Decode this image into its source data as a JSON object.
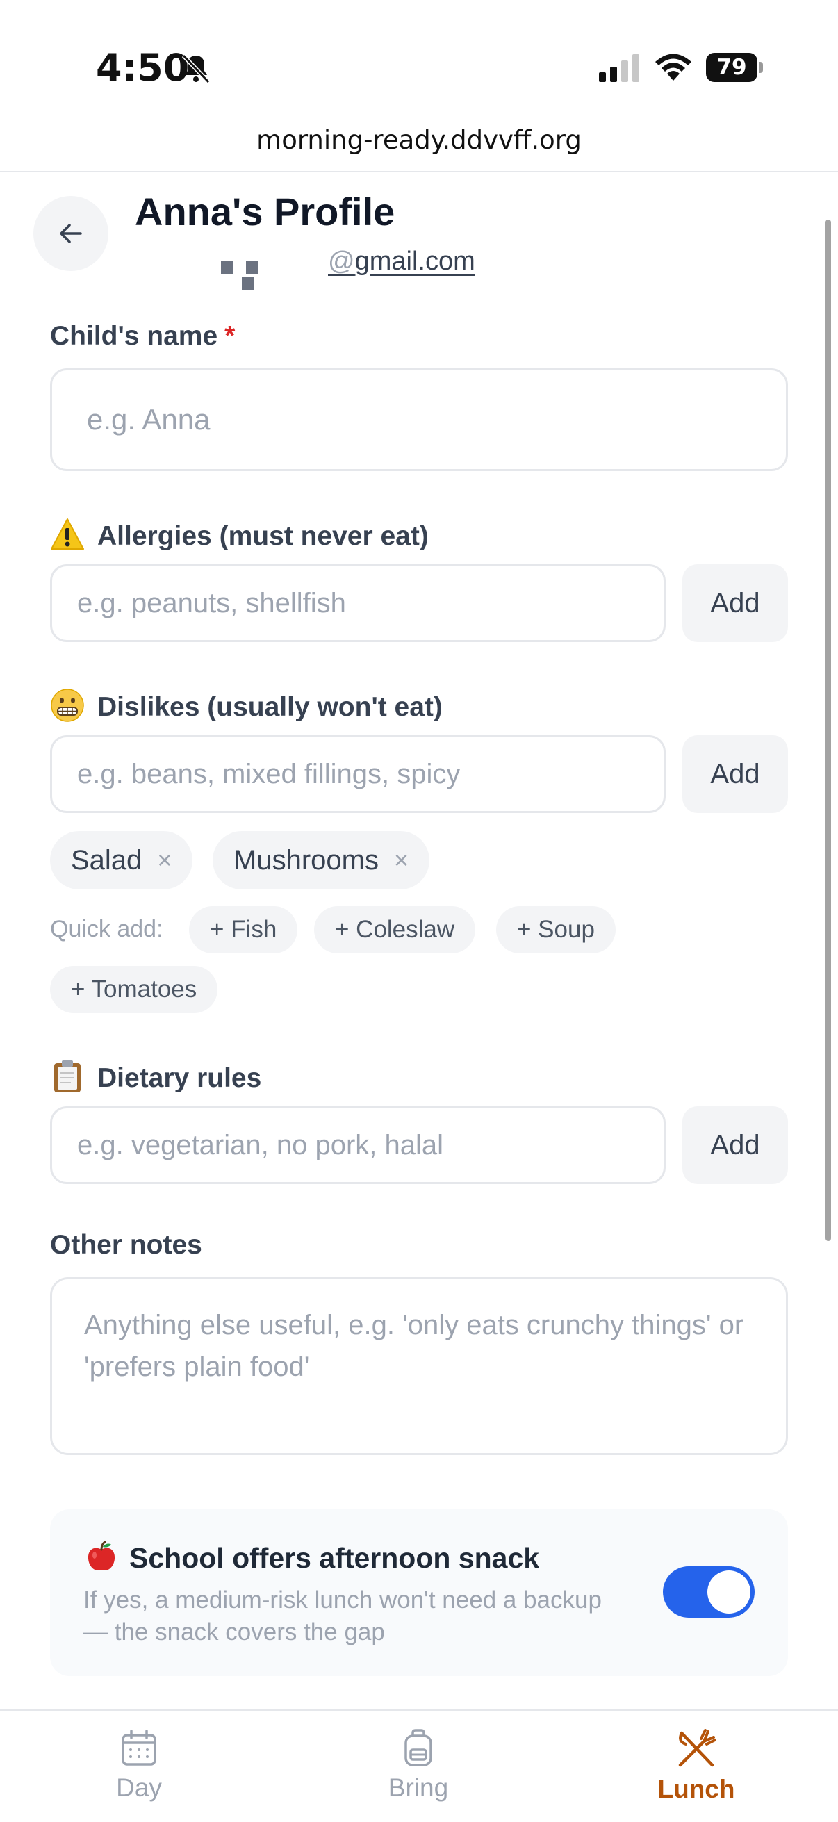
{
  "status_bar": {
    "time": "4:50",
    "battery": "79"
  },
  "browser": {
    "url": "morning-ready.ddvvff.org"
  },
  "header": {
    "title": "Anna's Profile",
    "email_visible": "gmail.com",
    "email_prefix_char": "@"
  },
  "child_name": {
    "label": "Child's name",
    "required_mark": "*",
    "placeholder": "e.g. Anna"
  },
  "allergies": {
    "label": "Allergies (must never eat)",
    "placeholder": "e.g. peanuts, shellfish",
    "add_label": "Add",
    "icon": "warning-icon"
  },
  "dislikes": {
    "label": "Dislikes (usually won't eat)",
    "placeholder": "e.g. beans, mixed fillings, spicy",
    "add_label": "Add",
    "icon": "grimace-face-icon",
    "tags": [
      "Salad",
      "Mushrooms"
    ],
    "remove_symbol": "×",
    "quick_add_label": "Quick add:",
    "quick_add": [
      "+ Fish",
      "+ Coleslaw",
      "+ Soup",
      "+ Tomatoes"
    ]
  },
  "dietary": {
    "label": "Dietary rules",
    "placeholder": "e.g. vegetarian, no pork, halal",
    "add_label": "Add",
    "icon": "clipboard-icon"
  },
  "notes": {
    "label": "Other notes",
    "placeholder": "Anything else useful, e.g. 'only eats crunchy things' or 'prefers plain food'"
  },
  "snack": {
    "title": "School offers afternoon snack",
    "description": "If yes, a medium-risk lunch won't need a backup — the snack covers the gap",
    "enabled": true,
    "icon": "apple-icon"
  },
  "nav": {
    "items": [
      {
        "label": "Day",
        "icon": "calendar-icon",
        "active": false
      },
      {
        "label": "Bring",
        "icon": "backpack-icon",
        "active": false
      },
      {
        "label": "Lunch",
        "icon": "utensils-icon",
        "active": true
      }
    ]
  },
  "colors": {
    "accent": "#2563eb",
    "active_nav": "#b45309",
    "required": "#dc2626"
  }
}
